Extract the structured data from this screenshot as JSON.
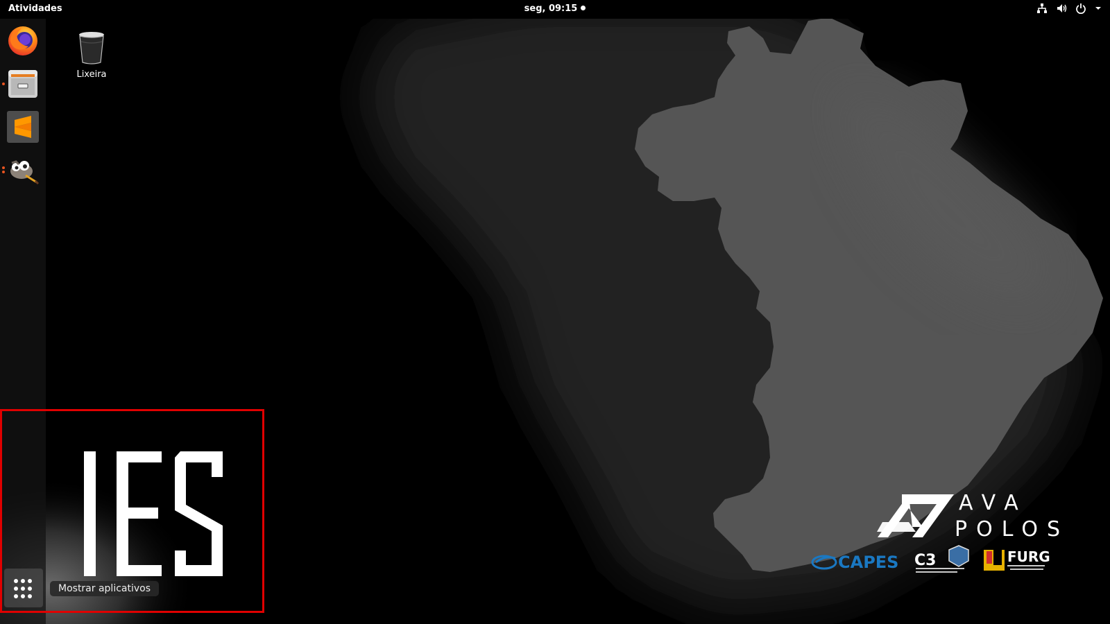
{
  "topbar": {
    "activities_label": "Atividades",
    "clock": "seg, 09:15",
    "tray_icons": [
      "network-icon",
      "volume-icon",
      "power-icon",
      "chevron-down-icon"
    ]
  },
  "dock": {
    "items": [
      {
        "name": "Firefox",
        "icon": "firefox-icon",
        "running": false
      },
      {
        "name": "Files",
        "icon": "files-icon",
        "running": true
      },
      {
        "name": "Sublime Text",
        "icon": "sublime-text-icon",
        "running": false
      },
      {
        "name": "GIMP",
        "icon": "gimp-icon",
        "running": true
      }
    ],
    "show_apps_tooltip": "Mostrar aplicativos"
  },
  "desktop": {
    "icons": [
      {
        "label": "Lixeira",
        "icon": "trash-icon"
      }
    ]
  },
  "wallpaper": {
    "big_text": "IES",
    "brand_top": "AVA",
    "brand_bottom": "POLOS",
    "partner_logos": [
      "CAPES",
      "C3",
      "FURG"
    ]
  },
  "colors": {
    "highlight": "#e00000",
    "accent_running": "#e95420",
    "capes_blue": "#1a78c2"
  }
}
